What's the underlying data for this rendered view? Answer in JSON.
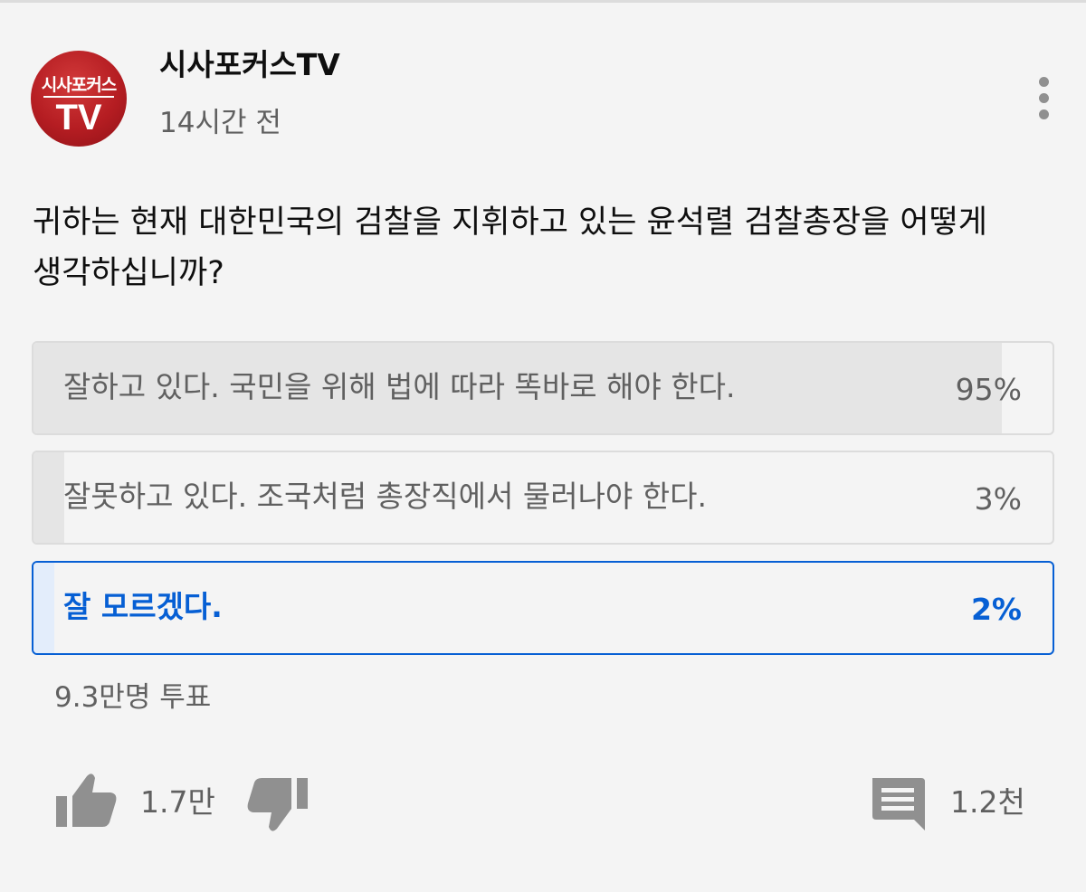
{
  "post": {
    "channel_name": "시사포커스TV",
    "time_ago": "14시간 전",
    "avatar": {
      "logo_top": "시사포커스",
      "logo_bottom": "TV",
      "bg_color": "#b51d22"
    },
    "menu_icon": "more-vertical-icon"
  },
  "poll": {
    "question": "귀하는 현재 대한민국의 검찰을 지휘하고 있는 윤석렬 검찰총장을 어떻게 생각하십니까?",
    "options": [
      {
        "label": "잘하고 있다. 국민을 위해 법에 따라 똑바로 해야 한다.",
        "percent_label": "95%",
        "fraction": 0.95,
        "selected": false
      },
      {
        "label": "잘못하고 있다. 조국처럼 총장직에서 물러나야 한다.",
        "percent_label": "3%",
        "fraction": 0.03,
        "selected": false
      },
      {
        "label": "잘 모르겠다.",
        "percent_label": "2%",
        "fraction": 0.02,
        "selected": true
      }
    ],
    "vote_count": "9.3만명 투표",
    "selected_color": "#065fd4"
  },
  "actions": {
    "like_icon": "thumbs-up-icon",
    "like_count": "1.7만",
    "dislike_icon": "thumbs-down-icon",
    "comment_icon": "comment-icon",
    "comment_count": "1.2천"
  }
}
